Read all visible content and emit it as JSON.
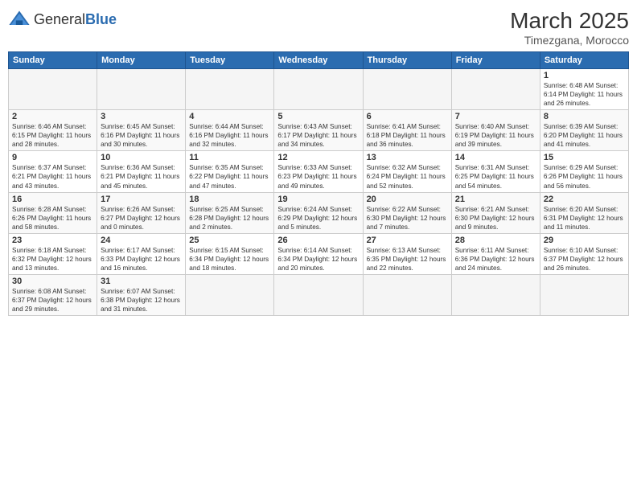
{
  "logo": {
    "text_general": "General",
    "text_blue": "Blue"
  },
  "title": "March 2025",
  "subtitle": "Timezgana, Morocco",
  "weekdays": [
    "Sunday",
    "Monday",
    "Tuesday",
    "Wednesday",
    "Thursday",
    "Friday",
    "Saturday"
  ],
  "weeks": [
    [
      {
        "day": "",
        "info": ""
      },
      {
        "day": "",
        "info": ""
      },
      {
        "day": "",
        "info": ""
      },
      {
        "day": "",
        "info": ""
      },
      {
        "day": "",
        "info": ""
      },
      {
        "day": "",
        "info": ""
      },
      {
        "day": "1",
        "info": "Sunrise: 6:48 AM\nSunset: 6:14 PM\nDaylight: 11 hours and 26 minutes."
      }
    ],
    [
      {
        "day": "2",
        "info": "Sunrise: 6:46 AM\nSunset: 6:15 PM\nDaylight: 11 hours and 28 minutes."
      },
      {
        "day": "3",
        "info": "Sunrise: 6:45 AM\nSunset: 6:16 PM\nDaylight: 11 hours and 30 minutes."
      },
      {
        "day": "4",
        "info": "Sunrise: 6:44 AM\nSunset: 6:16 PM\nDaylight: 11 hours and 32 minutes."
      },
      {
        "day": "5",
        "info": "Sunrise: 6:43 AM\nSunset: 6:17 PM\nDaylight: 11 hours and 34 minutes."
      },
      {
        "day": "6",
        "info": "Sunrise: 6:41 AM\nSunset: 6:18 PM\nDaylight: 11 hours and 36 minutes."
      },
      {
        "day": "7",
        "info": "Sunrise: 6:40 AM\nSunset: 6:19 PM\nDaylight: 11 hours and 39 minutes."
      },
      {
        "day": "8",
        "info": "Sunrise: 6:39 AM\nSunset: 6:20 PM\nDaylight: 11 hours and 41 minutes."
      }
    ],
    [
      {
        "day": "9",
        "info": "Sunrise: 6:37 AM\nSunset: 6:21 PM\nDaylight: 11 hours and 43 minutes."
      },
      {
        "day": "10",
        "info": "Sunrise: 6:36 AM\nSunset: 6:21 PM\nDaylight: 11 hours and 45 minutes."
      },
      {
        "day": "11",
        "info": "Sunrise: 6:35 AM\nSunset: 6:22 PM\nDaylight: 11 hours and 47 minutes."
      },
      {
        "day": "12",
        "info": "Sunrise: 6:33 AM\nSunset: 6:23 PM\nDaylight: 11 hours and 49 minutes."
      },
      {
        "day": "13",
        "info": "Sunrise: 6:32 AM\nSunset: 6:24 PM\nDaylight: 11 hours and 52 minutes."
      },
      {
        "day": "14",
        "info": "Sunrise: 6:31 AM\nSunset: 6:25 PM\nDaylight: 11 hours and 54 minutes."
      },
      {
        "day": "15",
        "info": "Sunrise: 6:29 AM\nSunset: 6:26 PM\nDaylight: 11 hours and 56 minutes."
      }
    ],
    [
      {
        "day": "16",
        "info": "Sunrise: 6:28 AM\nSunset: 6:26 PM\nDaylight: 11 hours and 58 minutes."
      },
      {
        "day": "17",
        "info": "Sunrise: 6:26 AM\nSunset: 6:27 PM\nDaylight: 12 hours and 0 minutes."
      },
      {
        "day": "18",
        "info": "Sunrise: 6:25 AM\nSunset: 6:28 PM\nDaylight: 12 hours and 2 minutes."
      },
      {
        "day": "19",
        "info": "Sunrise: 6:24 AM\nSunset: 6:29 PM\nDaylight: 12 hours and 5 minutes."
      },
      {
        "day": "20",
        "info": "Sunrise: 6:22 AM\nSunset: 6:30 PM\nDaylight: 12 hours and 7 minutes."
      },
      {
        "day": "21",
        "info": "Sunrise: 6:21 AM\nSunset: 6:30 PM\nDaylight: 12 hours and 9 minutes."
      },
      {
        "day": "22",
        "info": "Sunrise: 6:20 AM\nSunset: 6:31 PM\nDaylight: 12 hours and 11 minutes."
      }
    ],
    [
      {
        "day": "23",
        "info": "Sunrise: 6:18 AM\nSunset: 6:32 PM\nDaylight: 12 hours and 13 minutes."
      },
      {
        "day": "24",
        "info": "Sunrise: 6:17 AM\nSunset: 6:33 PM\nDaylight: 12 hours and 16 minutes."
      },
      {
        "day": "25",
        "info": "Sunrise: 6:15 AM\nSunset: 6:34 PM\nDaylight: 12 hours and 18 minutes."
      },
      {
        "day": "26",
        "info": "Sunrise: 6:14 AM\nSunset: 6:34 PM\nDaylight: 12 hours and 20 minutes."
      },
      {
        "day": "27",
        "info": "Sunrise: 6:13 AM\nSunset: 6:35 PM\nDaylight: 12 hours and 22 minutes."
      },
      {
        "day": "28",
        "info": "Sunrise: 6:11 AM\nSunset: 6:36 PM\nDaylight: 12 hours and 24 minutes."
      },
      {
        "day": "29",
        "info": "Sunrise: 6:10 AM\nSunset: 6:37 PM\nDaylight: 12 hours and 26 minutes."
      }
    ],
    [
      {
        "day": "30",
        "info": "Sunrise: 6:08 AM\nSunset: 6:37 PM\nDaylight: 12 hours and 29 minutes."
      },
      {
        "day": "31",
        "info": "Sunrise: 6:07 AM\nSunset: 6:38 PM\nDaylight: 12 hours and 31 minutes."
      },
      {
        "day": "",
        "info": ""
      },
      {
        "day": "",
        "info": ""
      },
      {
        "day": "",
        "info": ""
      },
      {
        "day": "",
        "info": ""
      },
      {
        "day": "",
        "info": ""
      }
    ]
  ]
}
